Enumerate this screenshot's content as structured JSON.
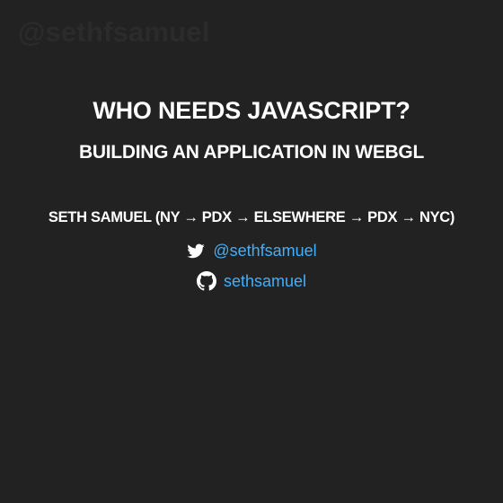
{
  "watermark": "@sethfsamuel",
  "title": "WHO NEEDS JAVASCRIPT?",
  "subtitle": "BUILDING AN APPLICATION IN WEBGL",
  "author": "SETH SAMUEL (NY → PDX → ELSEWHERE → PDX → NYC)",
  "links": {
    "twitter": {
      "icon": "twitter-bird-icon",
      "label": "@sethfsamuel"
    },
    "github": {
      "icon": "github-octocat-icon",
      "label": "sethsamuel"
    }
  },
  "colors": {
    "background": "#222222",
    "text": "#ffffff",
    "link": "#42affa",
    "watermark": "#2b2b2b"
  }
}
